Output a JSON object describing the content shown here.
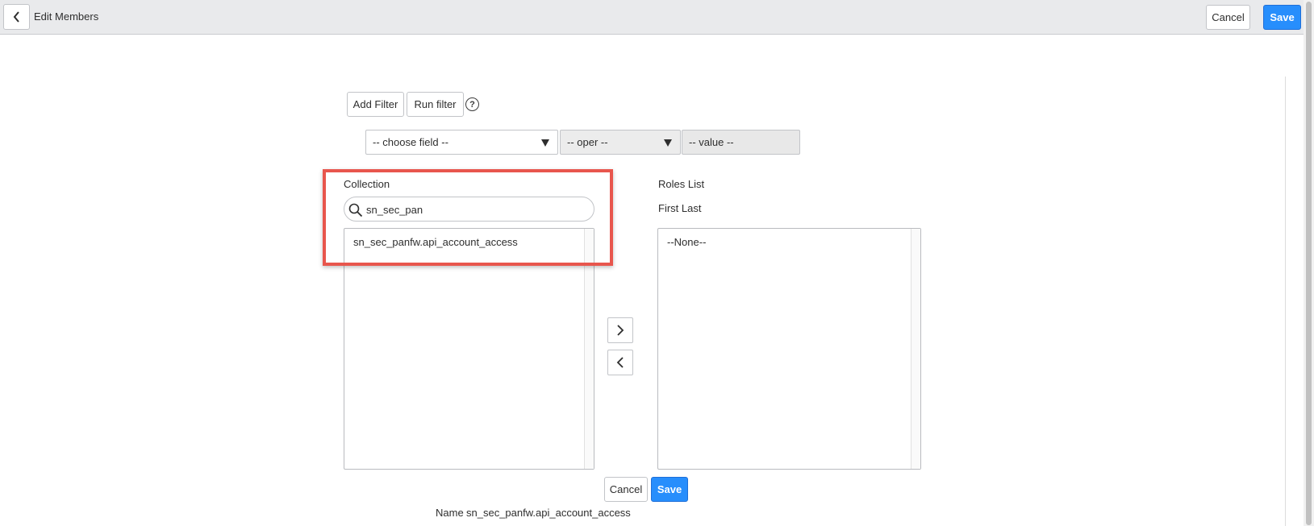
{
  "header": {
    "title": "Edit Members",
    "cancel_label": "Cancel",
    "save_label": "Save"
  },
  "filter": {
    "add_filter_label": "Add Filter",
    "run_filter_label": "Run filter",
    "help_glyph": "?",
    "field_select": "-- choose field --",
    "oper_select": "-- oper --",
    "value_field": "-- value --"
  },
  "collection": {
    "label": "Collection",
    "search_value": "sn_sec_pan",
    "items": [
      "sn_sec_panfw.api_account_access"
    ]
  },
  "roles": {
    "label": "Roles List",
    "sublabel": "First Last",
    "items": [
      "--None--"
    ]
  },
  "footer": {
    "cancel_label": "Cancel",
    "save_label": "Save",
    "name_label": "Name",
    "name_value": "sn_sec_panfw.api_account_access"
  },
  "colors": {
    "accent": "#278efc",
    "highlight": "#e8564d",
    "header_bg": "#e9eaec"
  },
  "icons": [
    "chevron-left-icon",
    "help-icon",
    "search-icon",
    "chevron-right-icon",
    "chevron-down-icon"
  ]
}
